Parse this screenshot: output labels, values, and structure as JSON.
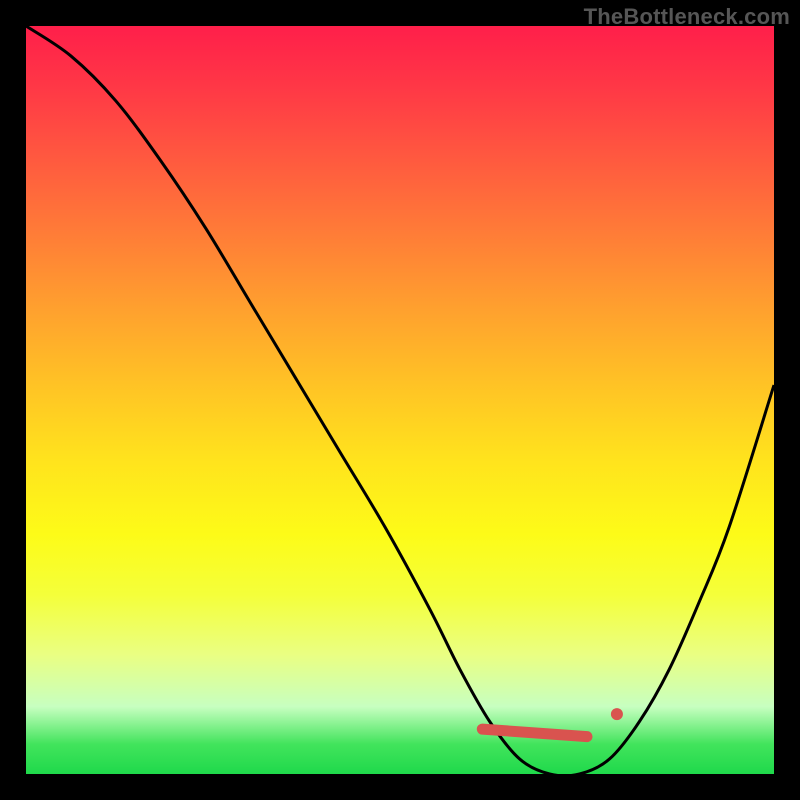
{
  "watermark": "TheBottleneck.com",
  "chart_data": {
    "type": "line",
    "title": "",
    "xlabel": "",
    "ylabel": "",
    "xlim": [
      0,
      100
    ],
    "ylim": [
      0,
      100
    ],
    "grid": false,
    "legend": false,
    "series": [
      {
        "name": "bottleneck-curve",
        "x": [
          0,
          6,
          12,
          18,
          24,
          30,
          36,
          42,
          48,
          54,
          58,
          62,
          66,
          70,
          74,
          78,
          82,
          86,
          90,
          94,
          100
        ],
        "values": [
          100,
          96,
          90,
          82,
          73,
          63,
          53,
          43,
          33,
          22,
          14,
          7,
          2,
          0,
          0,
          2,
          7,
          14,
          23,
          33,
          52
        ]
      }
    ],
    "markers": {
      "comment": "red highlighted optimum region near trough",
      "line_segment": {
        "x_start": 61,
        "y_start": 6,
        "x_end": 75,
        "y_end": 5
      },
      "dot": {
        "x": 79,
        "y": 8
      }
    },
    "background_gradient": {
      "top": "#ff1f4a",
      "mid": "#ffe31d",
      "bottom": "#1fd94b"
    }
  }
}
